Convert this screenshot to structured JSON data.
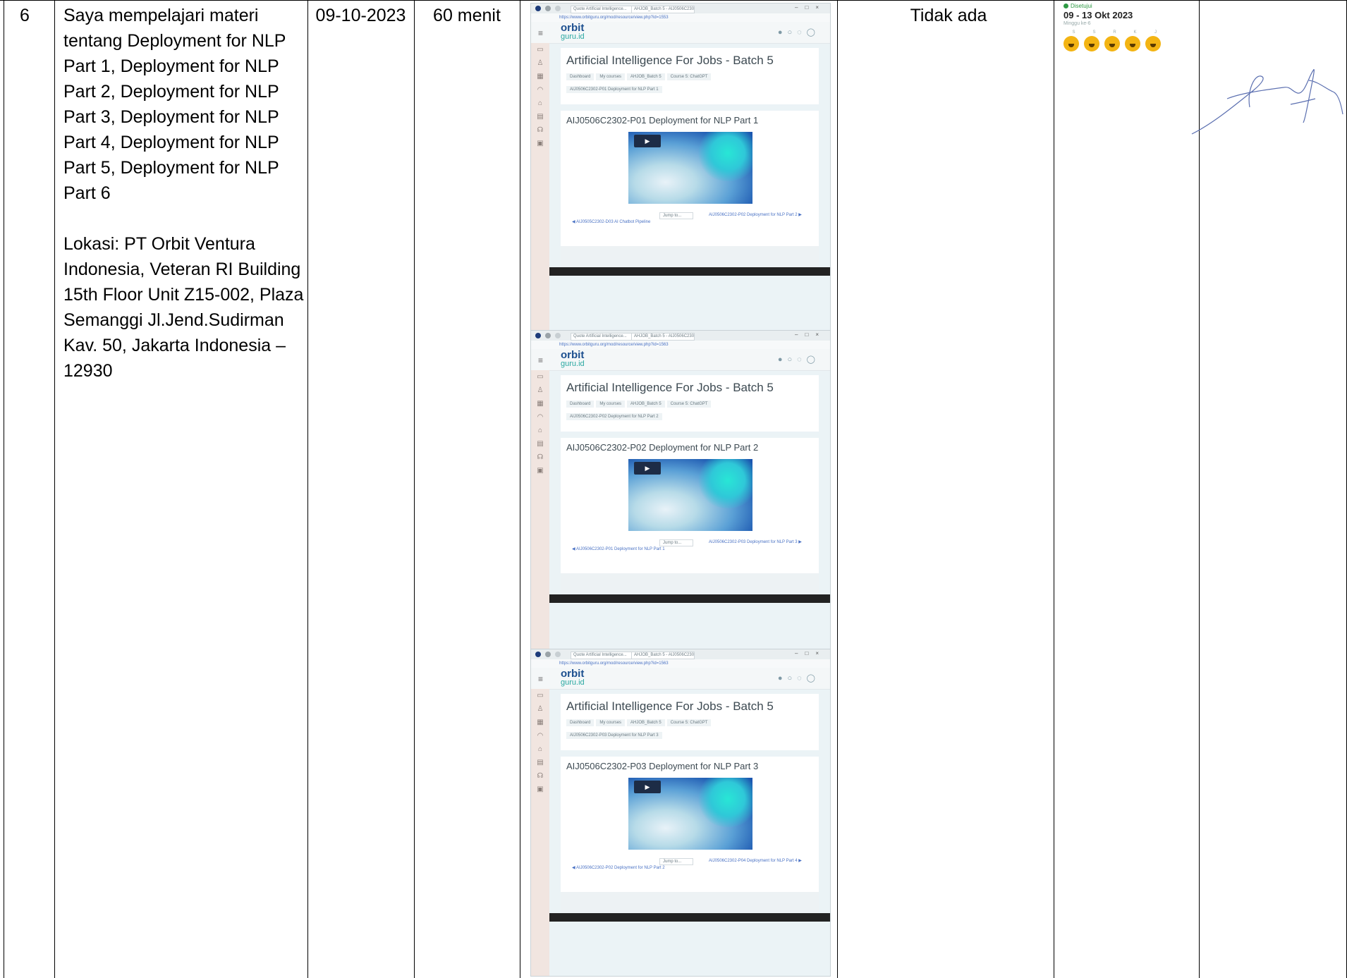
{
  "row": {
    "number": "6",
    "description": "Saya mempelajari materi tentang Deployment for NLP Part 1, Deployment for NLP Part 2, Deployment for NLP Part 3, Deployment for NLP Part 4, Deployment for NLP Part 5, Deployment for NLP Part 6",
    "location": "Lokasi: PT Orbit Ventura Indonesia, Veteran RI Building 15th Floor Unit Z15-002, Plaza Semanggi Jl.Jend.Sudirman Kav. 50, Jakarta Indonesia – 12930",
    "date": "09-10-2023",
    "duration": "60 menit",
    "problem": "Tidak ada"
  },
  "screenshots": [
    {
      "tab1": "Quote Artificial Intelligence...",
      "tab2": "AHJOB_Batch 5 - AIJ0506C2302...",
      "url": "https://www.orbitguru.org/mod/resource/view.php?id=1553",
      "logo_top": "orbit",
      "logo_bottom": "guru.id",
      "course_title": "Artificial Intelligence For Jobs - Batch 5",
      "crumbs": [
        "Dashboard",
        "My courses",
        "AHJOB_Batch 5",
        "Course 5: ChatGPT"
      ],
      "subcrumb": "AIJ0506C2302-P01 Deployment for NLP Part 1",
      "video_title": "AIJ0506C2302-P01 Deployment for NLP Part 1",
      "jump": "Jump to...",
      "next": "AIJ0506C2302-P02 Deployment for NLP Part 2 ▶",
      "prev": "◀ AIJ0505C2302-D03 AI Chatbot Pipeline"
    },
    {
      "tab1": "Quote Artificial Intelligence...",
      "tab2": "AHJOB_Batch 5 - AIJ0506C2302...",
      "url": "https://www.orbitguru.org/mod/resource/view.php?id=1563",
      "logo_top": "orbit",
      "logo_bottom": "guru.id",
      "course_title": "Artificial Intelligence For Jobs - Batch 5",
      "crumbs": [
        "Dashboard",
        "My courses",
        "AHJOB_Batch 5",
        "Course 5: ChatGPT"
      ],
      "subcrumb": "AIJ0506C2302-P02 Deployment for NLP Part 2",
      "video_title": "AIJ0506C2302-P02 Deployment for NLP Part 2",
      "jump": "Jump to...",
      "next": "AIJ0506C2302-P03 Deployment for NLP Part 3 ▶",
      "prev": "◀ AIJ0506C2302-P01 Deployment for NLP Part 1"
    },
    {
      "tab1": "Quote Artificial Intelligence...",
      "tab2": "AHJOB_Batch 5 - AIJ0506C2302...",
      "url": "https://www.orbitguru.org/mod/resource/view.php?id=1563",
      "logo_top": "orbit",
      "logo_bottom": "guru.id",
      "course_title": "Artificial Intelligence For Jobs - Batch 5",
      "crumbs": [
        "Dashboard",
        "My courses",
        "AHJOB_Batch 5",
        "Course 5: ChatGPT"
      ],
      "subcrumb": "AIJ0506C2302-P03 Deployment for NLP Part 3",
      "video_title": "AIJ0506C2302-P03 Deployment for NLP Part 3",
      "jump": "Jump to...",
      "next": "AIJ0506C2302-P04 Deployment for NLP Part 4 ▶",
      "prev": "◀ AIJ0506C2302-P02 Deployment for NLP Part 2"
    }
  ],
  "rating": {
    "status": "Disetujui",
    "range": "09 - 13 Okt 2023",
    "sub": "Minggu ke-6",
    "days": [
      "S",
      "S",
      "R",
      "K",
      "J"
    ],
    "face_color": "#f3b413"
  }
}
